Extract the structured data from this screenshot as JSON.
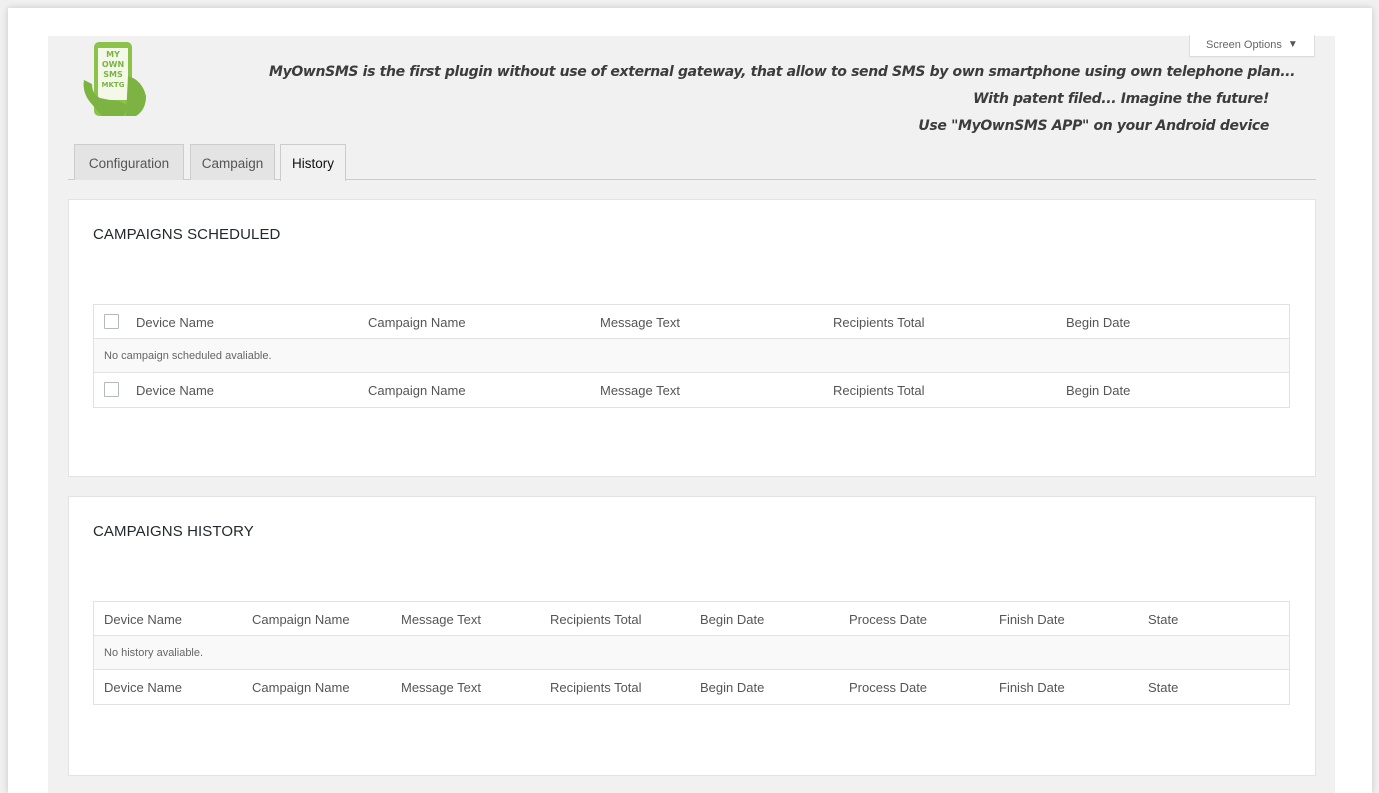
{
  "screen_options": {
    "label": "Screen Options",
    "arrow": "▼"
  },
  "logo": {
    "lines": [
      "MY",
      "OWN",
      "SMS",
      "MKTG"
    ],
    "color": "#8bc34a"
  },
  "tagline": [
    "MyOwnSMS is the first plugin without use of external gateway, that allow to send SMS by own smartphone using own telephone plan...",
    "With patent filed... Imagine the future!",
    "Use \"MyOwnSMS APP\" on your Android device"
  ],
  "tabs": [
    {
      "label": "Configuration",
      "active": false
    },
    {
      "label": "Campaign",
      "active": false
    },
    {
      "label": "History",
      "active": true
    }
  ],
  "scheduled": {
    "title": "CAMPAIGNS SCHEDULED",
    "columns": [
      "Device Name",
      "Campaign Name",
      "Message Text",
      "Recipients Total",
      "Begin Date"
    ],
    "empty_text": "No campaign scheduled avaliable."
  },
  "history": {
    "title": "CAMPAIGNS HISTORY",
    "columns": [
      "Device Name",
      "Campaign Name",
      "Message Text",
      "Recipients Total",
      "Begin Date",
      "Process Date",
      "Finish Date",
      "State"
    ],
    "empty_text": "No history avaliable."
  }
}
